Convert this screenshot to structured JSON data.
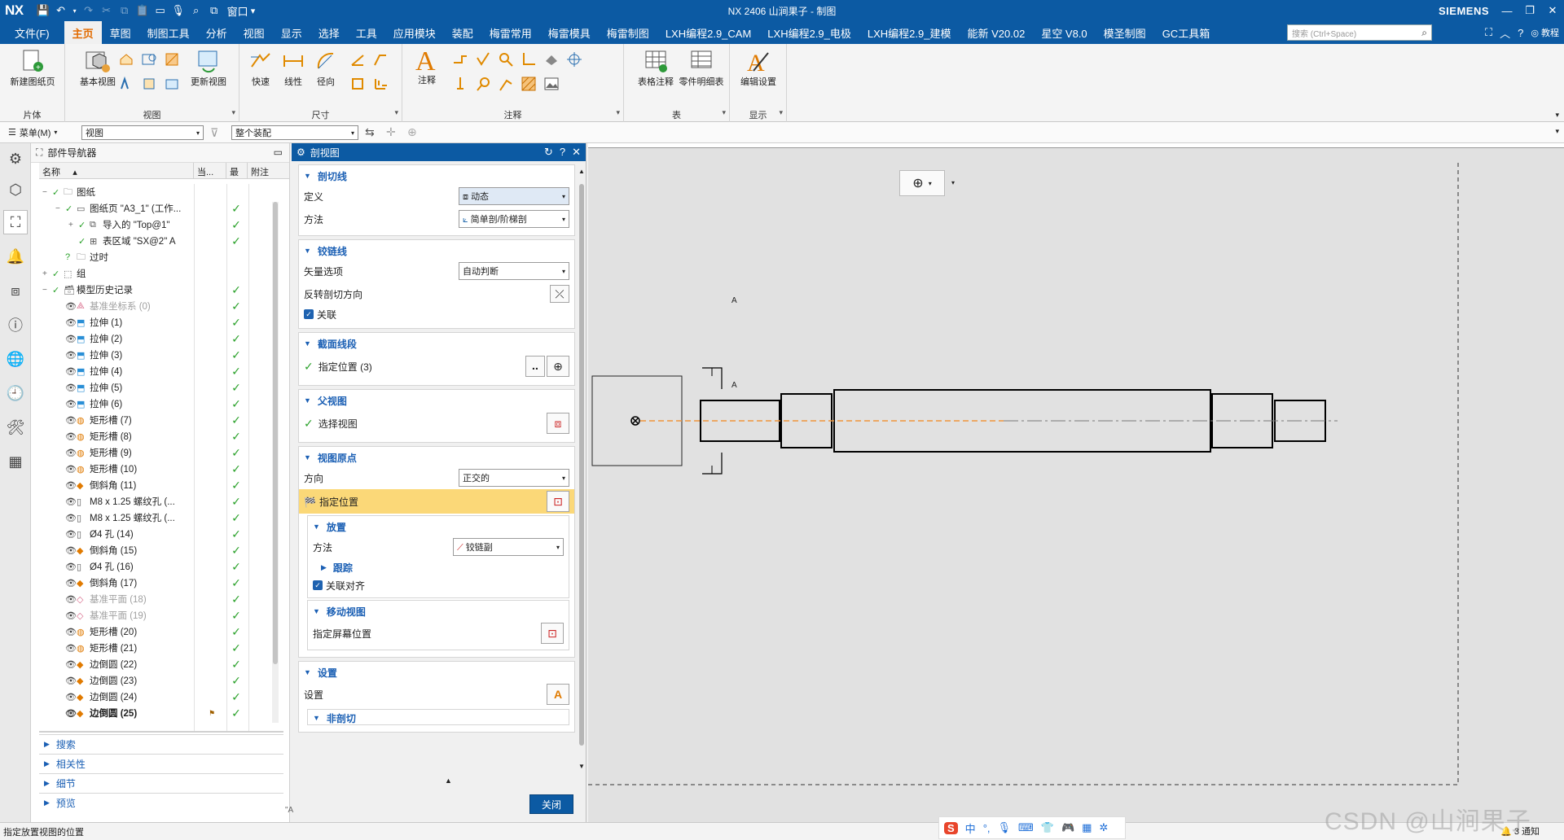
{
  "window": {
    "app_logo": "NX",
    "title": "NX 2406 山涧果子 - 制图",
    "window_menu": "窗口",
    "brand": "SIEMENS"
  },
  "menu": {
    "file": "文件(F)",
    "tabs": [
      "主页",
      "草图",
      "制图工具",
      "分析",
      "视图",
      "显示",
      "选择",
      "工具",
      "应用模块",
      "装配",
      "梅雷常用",
      "梅雷模具",
      "梅雷制图",
      "LXH编程2.9_CAM",
      "LXH编程2.9_电极",
      "LXH编程2.9_建模",
      "能新 V20.02",
      "星空 V8.0",
      "模圣制图",
      "GC工具箱"
    ],
    "active_tab": "主页",
    "search_placeholder": "搜索 (Ctrl+Space)",
    "tutorial": "教程"
  },
  "ribbon": {
    "groups": {
      "sheet": "片体",
      "view": "视图",
      "dimension": "尺寸",
      "annotation": "注释",
      "table": "表",
      "display": "显示"
    },
    "buttons": {
      "new_sheet": "新建图纸页",
      "base_view": "基本视图",
      "update_view": "更新视图",
      "rapid": "快速",
      "linear": "线性",
      "radial": "径向",
      "note": "注释",
      "tabular_note": "表格注释",
      "parts_list": "零件明细表",
      "edit_settings": "编辑设置"
    }
  },
  "toolbar": {
    "menu": "菜单(M)",
    "filter_value": "视图",
    "scope_value": "整个装配"
  },
  "navigator": {
    "title": "部件导航器",
    "col_name": "名称",
    "col_current": "当...",
    "col_latest": "最",
    "col_attach": "附注",
    "rows": [
      {
        "label": "图纸",
        "indent": 0,
        "exp": "−",
        "dim": false
      },
      {
        "label": "图纸页 \"A3_1\" (工作...",
        "indent": 1,
        "exp": "−",
        "dim": false
      },
      {
        "label": "导入的 \"Top@1\"",
        "indent": 2,
        "exp": "+",
        "dim": false
      },
      {
        "label": "表区域 \"SX@2\" A",
        "indent": 2,
        "exp": "",
        "dim": false
      },
      {
        "label": "过时",
        "indent": 1,
        "exp": "",
        "dim": false
      },
      {
        "label": "组",
        "indent": 0,
        "exp": "+",
        "dim": false
      },
      {
        "label": "模型历史记录",
        "indent": 0,
        "exp": "−",
        "dim": false
      },
      {
        "label": "基准坐标系 (0)",
        "indent": 1,
        "exp": "",
        "dim": true
      },
      {
        "label": "拉伸 (1)",
        "indent": 1,
        "exp": "",
        "dim": false
      },
      {
        "label": "拉伸 (2)",
        "indent": 1,
        "exp": "",
        "dim": false
      },
      {
        "label": "拉伸 (3)",
        "indent": 1,
        "exp": "",
        "dim": false
      },
      {
        "label": "拉伸 (4)",
        "indent": 1,
        "exp": "",
        "dim": false
      },
      {
        "label": "拉伸 (5)",
        "indent": 1,
        "exp": "",
        "dim": false
      },
      {
        "label": "拉伸 (6)",
        "indent": 1,
        "exp": "",
        "dim": false
      },
      {
        "label": "矩形槽 (7)",
        "indent": 1,
        "exp": "",
        "dim": false
      },
      {
        "label": "矩形槽 (8)",
        "indent": 1,
        "exp": "",
        "dim": false
      },
      {
        "label": "矩形槽 (9)",
        "indent": 1,
        "exp": "",
        "dim": false
      },
      {
        "label": "矩形槽 (10)",
        "indent": 1,
        "exp": "",
        "dim": false
      },
      {
        "label": "倒斜角 (11)",
        "indent": 1,
        "exp": "",
        "dim": false
      },
      {
        "label": "M8 x 1.25 螺纹孔 (...",
        "indent": 1,
        "exp": "",
        "dim": false
      },
      {
        "label": "M8 x 1.25 螺纹孔 (...",
        "indent": 1,
        "exp": "",
        "dim": false
      },
      {
        "label": "Ø4 孔 (14)",
        "indent": 1,
        "exp": "",
        "dim": false
      },
      {
        "label": "倒斜角 (15)",
        "indent": 1,
        "exp": "",
        "dim": false
      },
      {
        "label": "Ø4 孔 (16)",
        "indent": 1,
        "exp": "",
        "dim": false
      },
      {
        "label": "倒斜角 (17)",
        "indent": 1,
        "exp": "",
        "dim": false
      },
      {
        "label": "基准平面 (18)",
        "indent": 1,
        "exp": "",
        "dim": true
      },
      {
        "label": "基准平面 (19)",
        "indent": 1,
        "exp": "",
        "dim": true
      },
      {
        "label": "矩形槽 (20)",
        "indent": 1,
        "exp": "",
        "dim": false
      },
      {
        "label": "矩形槽 (21)",
        "indent": 1,
        "exp": "",
        "dim": false
      },
      {
        "label": "边倒圆 (22)",
        "indent": 1,
        "exp": "",
        "dim": false
      },
      {
        "label": "边倒圆 (23)",
        "indent": 1,
        "exp": "",
        "dim": false
      },
      {
        "label": "边倒圆 (24)",
        "indent": 1,
        "exp": "",
        "dim": false
      },
      {
        "label": "边倒圆 (25)",
        "indent": 1,
        "exp": "",
        "dim": false
      }
    ],
    "sections": [
      "搜索",
      "相关性",
      "细节",
      "预览"
    ]
  },
  "dialog": {
    "title": "剖视图",
    "s_cutline": "剖切线",
    "definition_label": "定义",
    "definition_value": "动态",
    "method_label": "方法",
    "method_value": "简单剖/阶梯剖",
    "s_hinge": "铰链线",
    "vector_label": "矢量选项",
    "vector_value": "自动判断",
    "reverse_label": "反转剖切方向",
    "associative_label": "关联",
    "s_segment": "截面线段",
    "specify_location_count": "指定位置 (3)",
    "s_parent": "父视图",
    "select_view": "选择视图",
    "s_origin": "视图原点",
    "orientation_label": "方向",
    "orientation_value": "正交的",
    "specify_location": "指定位置",
    "s_placement": "放置",
    "placement_method_label": "方法",
    "placement_method_value": "铰链副",
    "tracking": "跟踪",
    "associative_align": "关联对齐",
    "s_move_view": "移动视图",
    "specify_screen_pos": "指定屏幕位置",
    "s_settings": "设置",
    "settings_label": "设置",
    "non_section": "非剖切",
    "close": "关闭"
  },
  "canvas": {
    "section_label": "A"
  },
  "status": {
    "prompt": "指定放置视图的位置",
    "notifications": "3 通知",
    "ime_lang": "中",
    "watermark": "CSDN @山涧果子"
  }
}
